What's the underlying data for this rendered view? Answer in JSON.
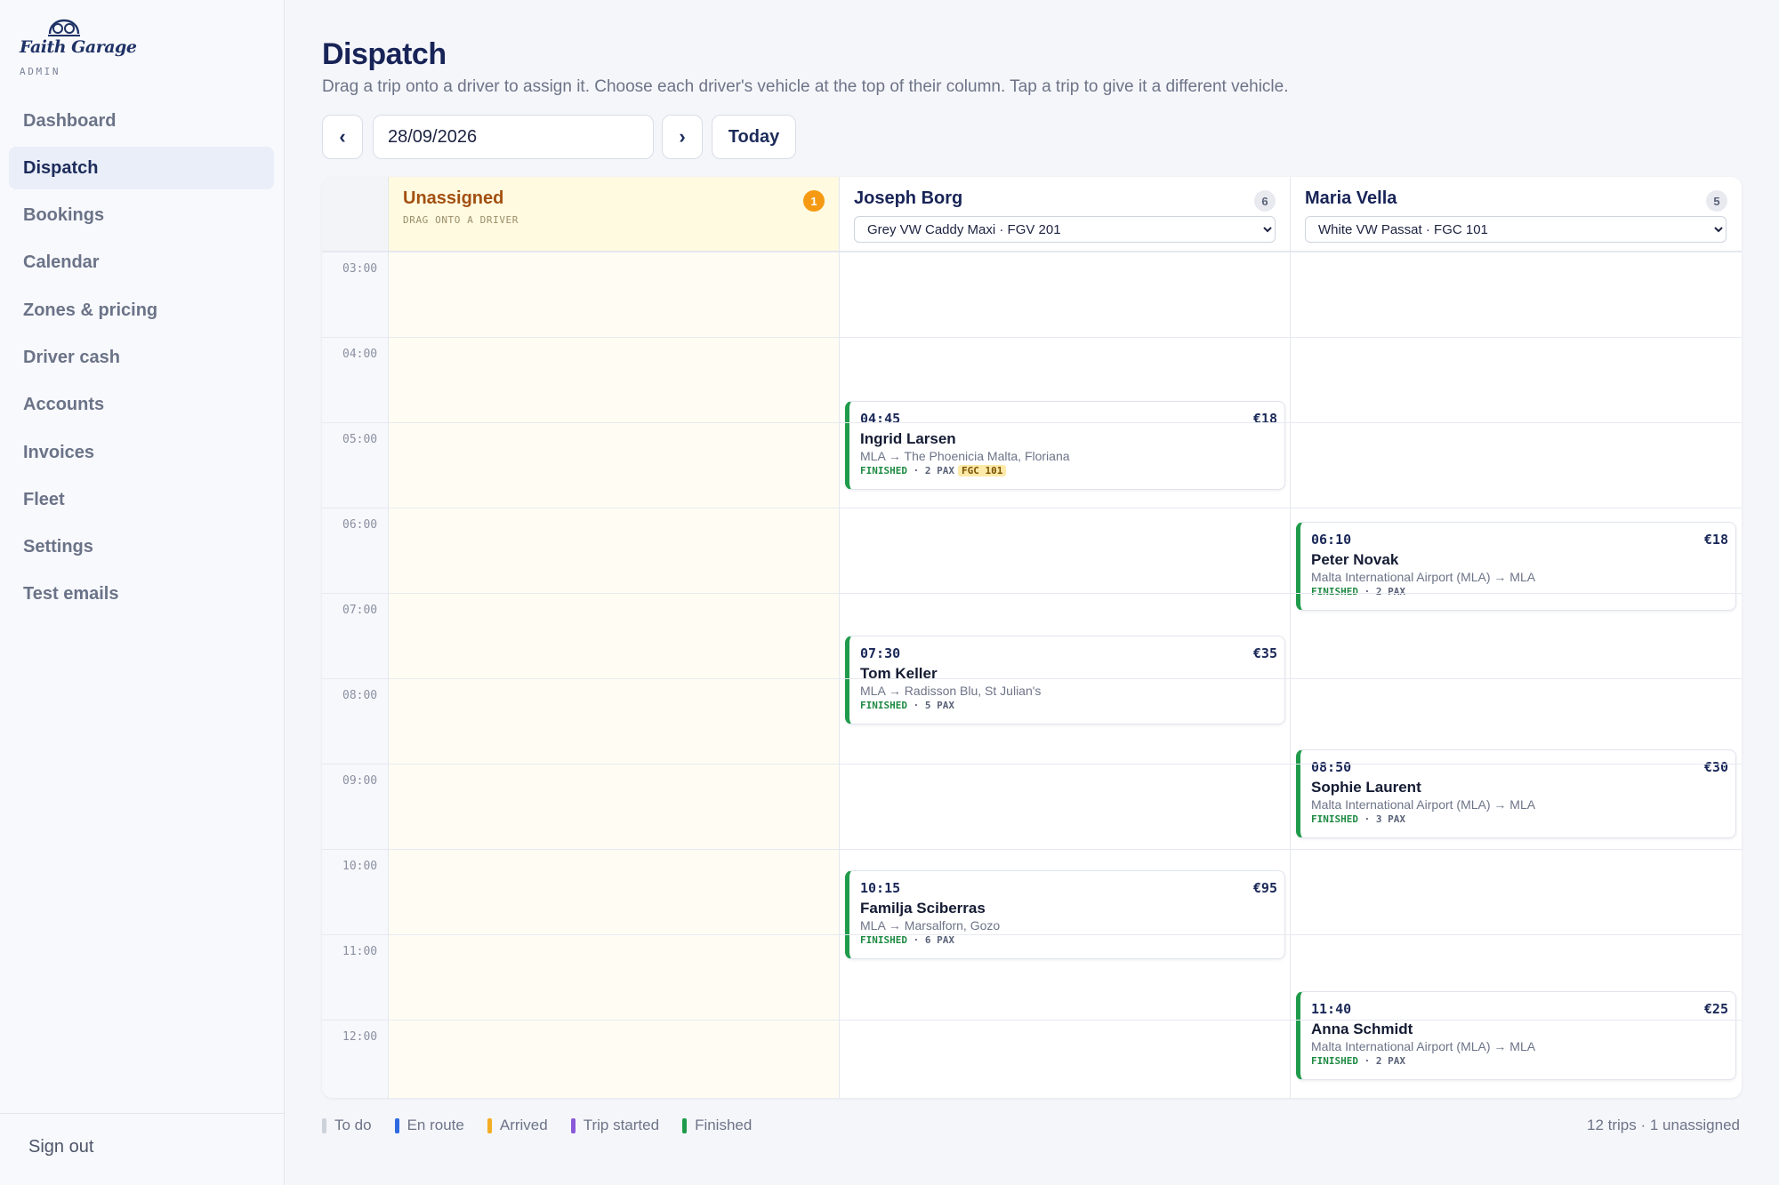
{
  "brand": {
    "name": "Faith Garage",
    "sub": "ADMIN"
  },
  "sidebar": {
    "items": [
      {
        "label": "Dashboard",
        "active": false
      },
      {
        "label": "Dispatch",
        "active": true
      },
      {
        "label": "Bookings",
        "active": false
      },
      {
        "label": "Calendar",
        "active": false
      },
      {
        "label": "Zones & pricing",
        "active": false
      },
      {
        "label": "Driver cash",
        "active": false
      },
      {
        "label": "Accounts",
        "active": false
      },
      {
        "label": "Invoices",
        "active": false
      },
      {
        "label": "Fleet",
        "active": false
      },
      {
        "label": "Settings",
        "active": false
      },
      {
        "label": "Test emails",
        "active": false
      }
    ],
    "signout": "Sign out"
  },
  "header": {
    "title": "Dispatch",
    "subtitle": "Drag a trip onto a driver to assign it. Choose each driver's vehicle at the top of their column. Tap a trip to give it a different vehicle."
  },
  "datebar": {
    "prev_icon": "‹",
    "date": "28/09/2026",
    "next_icon": "›",
    "today_label": "Today"
  },
  "hours": [
    "03:00",
    "04:00",
    "05:00",
    "06:00",
    "07:00",
    "08:00",
    "09:00",
    "10:00",
    "11:00",
    "12:00"
  ],
  "columns": {
    "unassigned": {
      "title": "Unassigned",
      "count": "1",
      "hint": "DRAG ONTO A DRIVER"
    },
    "joseph": {
      "title": "Joseph Borg",
      "count": "6",
      "vehicle": "Grey VW Caddy Maxi · FGV 201",
      "trips": [
        {
          "time": "04:45",
          "price": "€18",
          "name": "Ingrid Larsen",
          "route": "MLA → The Phoenicia Malta, Floriana",
          "status": "FINISHED",
          "pax": "2 PAX",
          "tag": "FGC 101"
        },
        {
          "time": "07:30",
          "price": "€35",
          "name": "Tom Keller",
          "route": "MLA → Radisson Blu, St Julian's",
          "status": "FINISHED",
          "pax": "5 PAX"
        },
        {
          "time": "10:15",
          "price": "€95",
          "name": "Familja Sciberras",
          "route": "MLA → Marsalforn, Gozo",
          "status": "FINISHED",
          "pax": "6 PAX"
        }
      ]
    },
    "maria": {
      "title": "Maria Vella",
      "count": "5",
      "vehicle": "White VW Passat · FGC 101",
      "trips": [
        {
          "time": "06:10",
          "price": "€18",
          "name": "Peter Novak",
          "route": "Malta International Airport (MLA) → MLA",
          "status": "FINISHED",
          "pax": "2 PAX"
        },
        {
          "time": "08:50",
          "price": "€30",
          "name": "Sophie Laurent",
          "route": "Malta International Airport (MLA) → MLA",
          "status": "FINISHED",
          "pax": "3 PAX"
        },
        {
          "time": "11:40",
          "price": "€25",
          "name": "Anna Schmidt",
          "route": "Malta International Airport (MLA) → MLA",
          "status": "FINISHED",
          "pax": "2 PAX"
        }
      ]
    }
  },
  "legend": [
    {
      "label": "To do",
      "color": "#cdd1da"
    },
    {
      "label": "En route",
      "color": "#2f6ae0"
    },
    {
      "label": "Arrived",
      "color": "#f2ad24"
    },
    {
      "label": "Trip started",
      "color": "#8a5ad8"
    },
    {
      "label": "Finished",
      "color": "#1f9b4b"
    }
  ],
  "summary": "12 trips · 1 unassigned"
}
